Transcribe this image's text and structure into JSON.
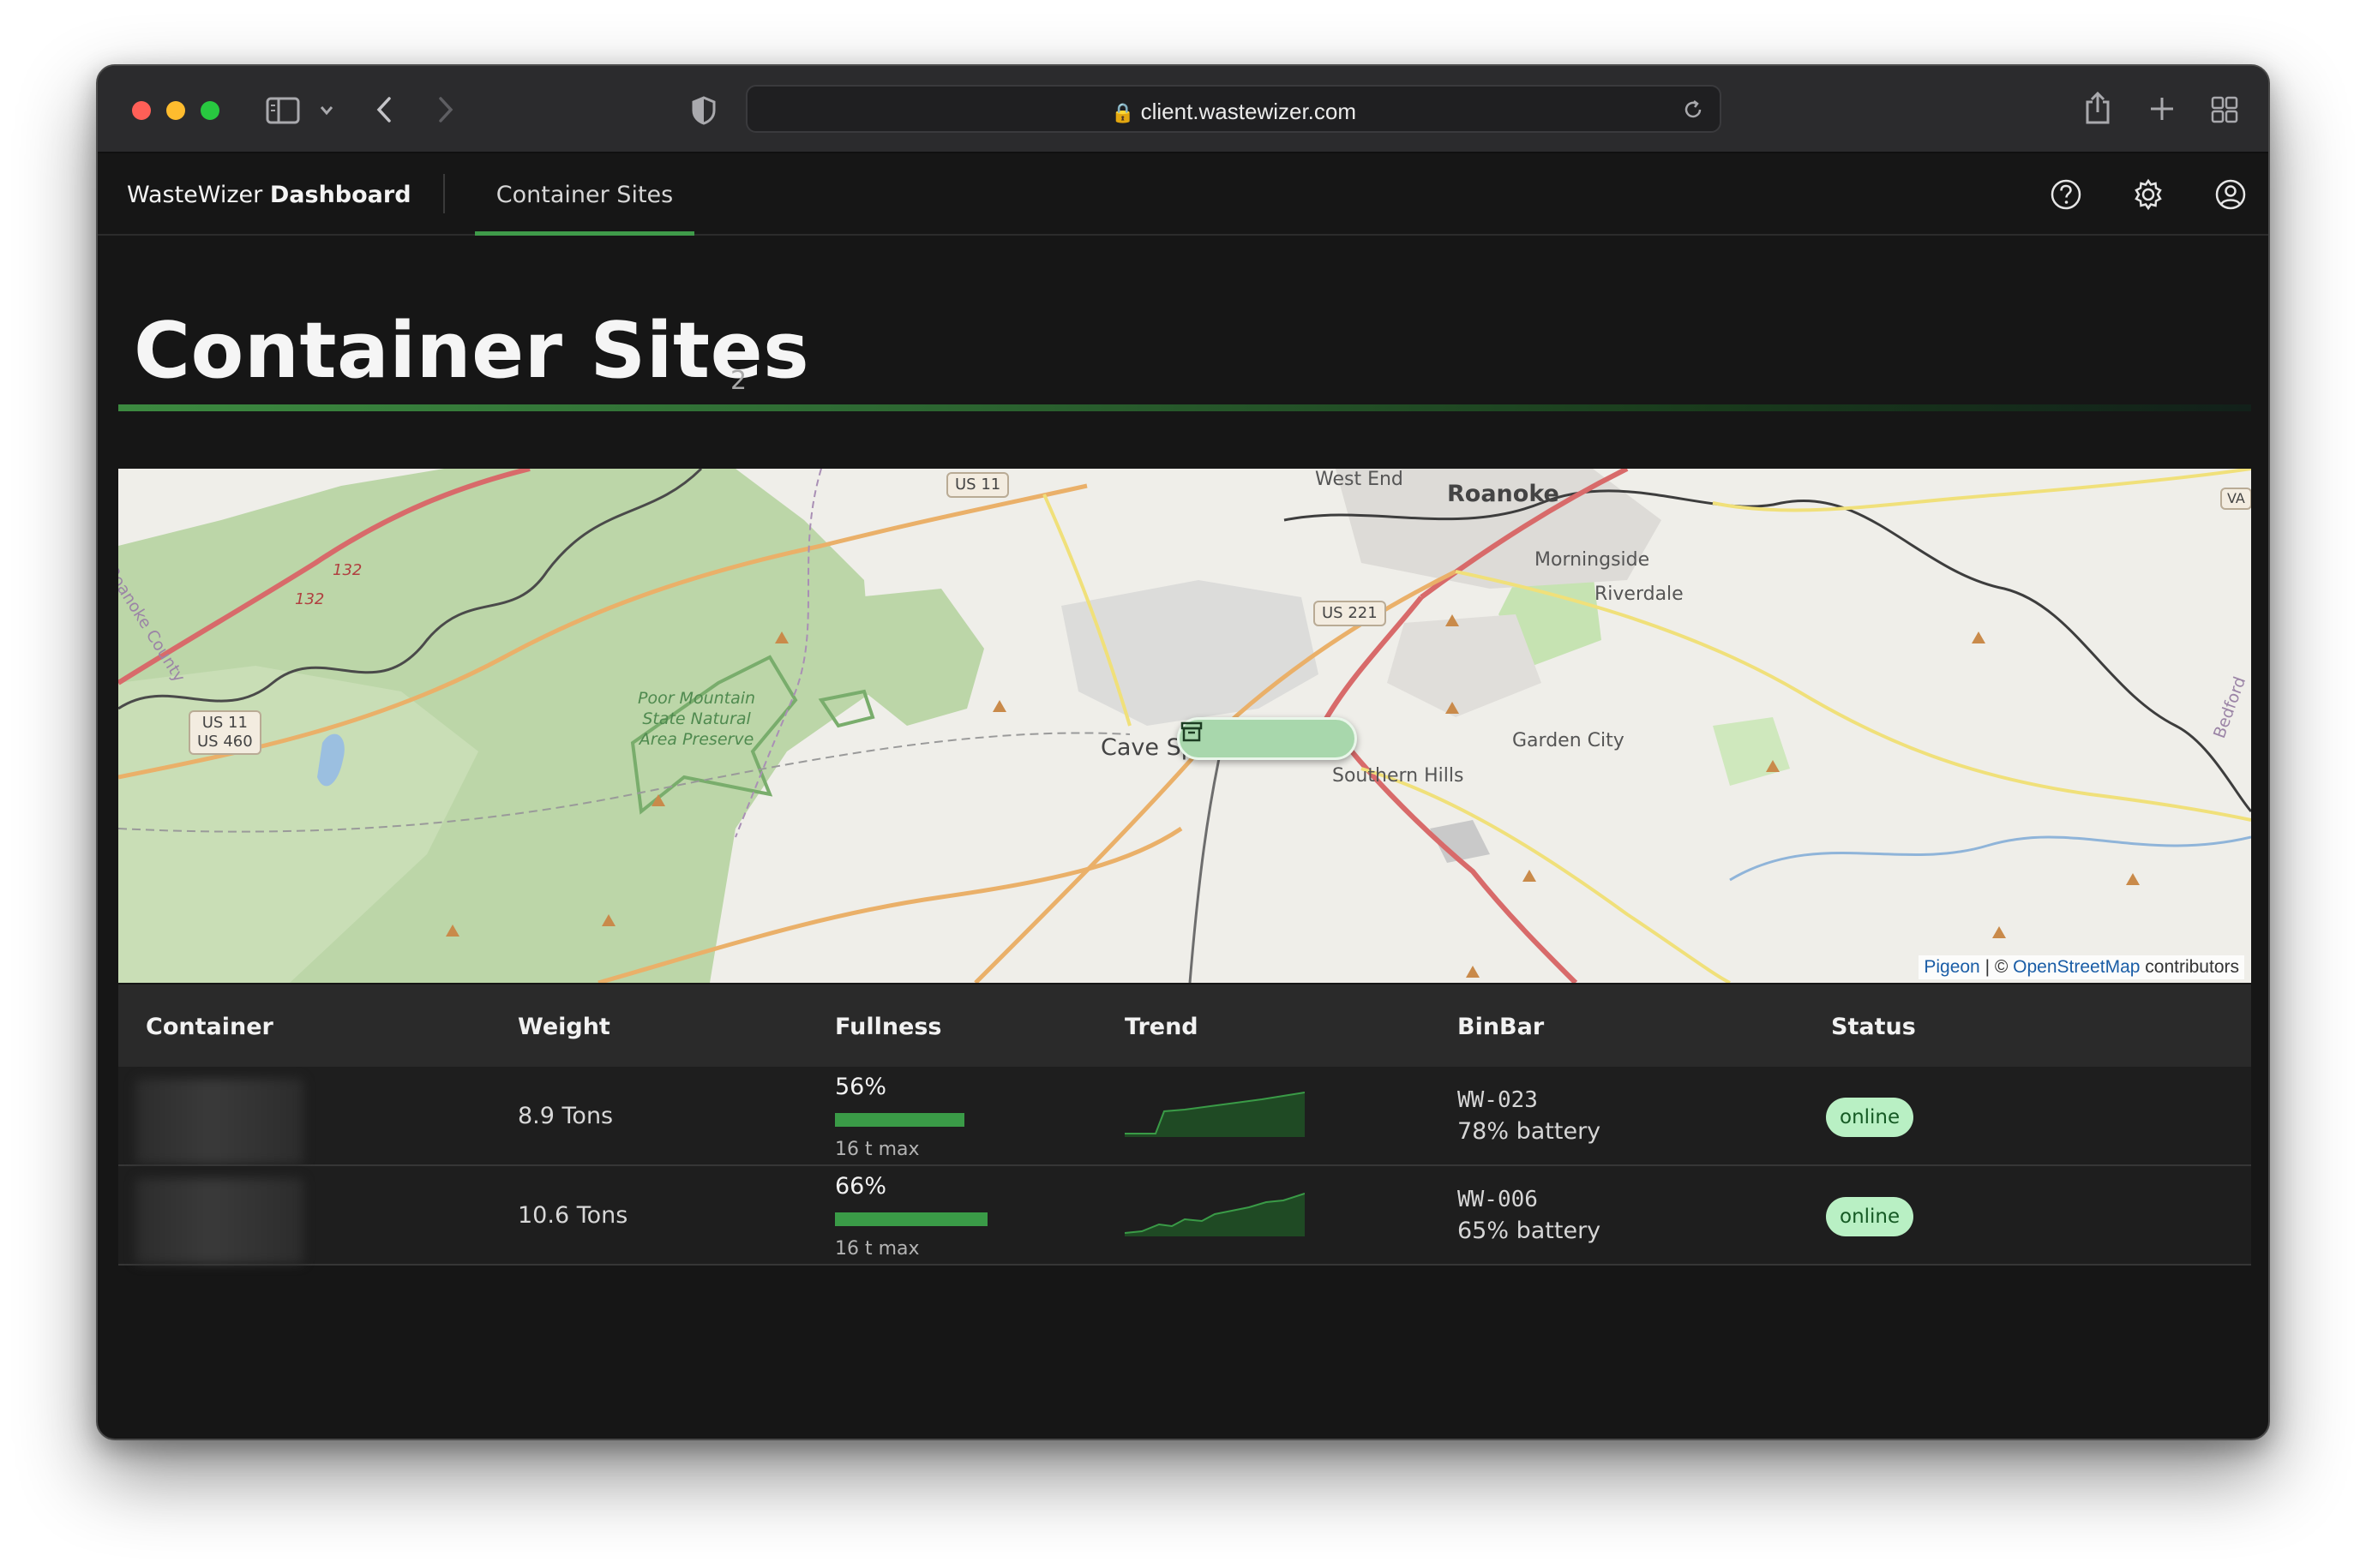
{
  "browser": {
    "url": "client.wastewizer.com"
  },
  "nav": {
    "brand_light": "WasteWizer",
    "brand_bold": "Dashboard",
    "tab": "Container Sites",
    "icons": [
      "help-icon",
      "settings-icon",
      "user-icon"
    ]
  },
  "page": {
    "title": "Container Sites",
    "count": "2"
  },
  "map": {
    "labels": {
      "roanoke": "Roanoke",
      "west_end": "West End",
      "morningside": "Morningside",
      "riverdale": "Riverdale",
      "garden_city": "Garden City",
      "southern_hills": "Southern Hills",
      "cave_spring": "Cave Sp",
      "roanoke_county": "Roanoke County",
      "bedford": "Bedford",
      "park_line1": "Poor Mountain",
      "park_line2": "State Natural",
      "park_line3": "Area Preserve"
    },
    "shields": {
      "us11_top": "US 11",
      "us221": "US 221",
      "us11_us460_a": "US 11",
      "us11_us460_b": "US 460",
      "r132_a": "132",
      "r132_b": "132",
      "va": "VA"
    },
    "attribution": {
      "pigeon": "Pigeon",
      "sep": " | © ",
      "osm": "OpenStreetMap",
      "contributors": " contributors"
    }
  },
  "table": {
    "headers": {
      "container": "Container",
      "weight": "Weight",
      "fullness": "Fullness",
      "trend": "Trend",
      "binbar": "BinBar",
      "status": "Status"
    },
    "rows": [
      {
        "weight": "8.9 Tons",
        "fullness_pct": "56%",
        "fullness_value": 0.56,
        "fullness_max": "16 t max",
        "binbar_id": "WW-023",
        "binbar_battery": "78% battery",
        "status": "online"
      },
      {
        "weight": "10.6 Tons",
        "fullness_pct": "66%",
        "fullness_value": 0.66,
        "fullness_max": "16 t max",
        "binbar_id": "WW-006",
        "binbar_battery": "65% battery",
        "status": "online"
      }
    ]
  },
  "colors": {
    "accent_green": "#3a9b47",
    "status_bg": "#b9f0c4",
    "status_text": "#155a24"
  }
}
